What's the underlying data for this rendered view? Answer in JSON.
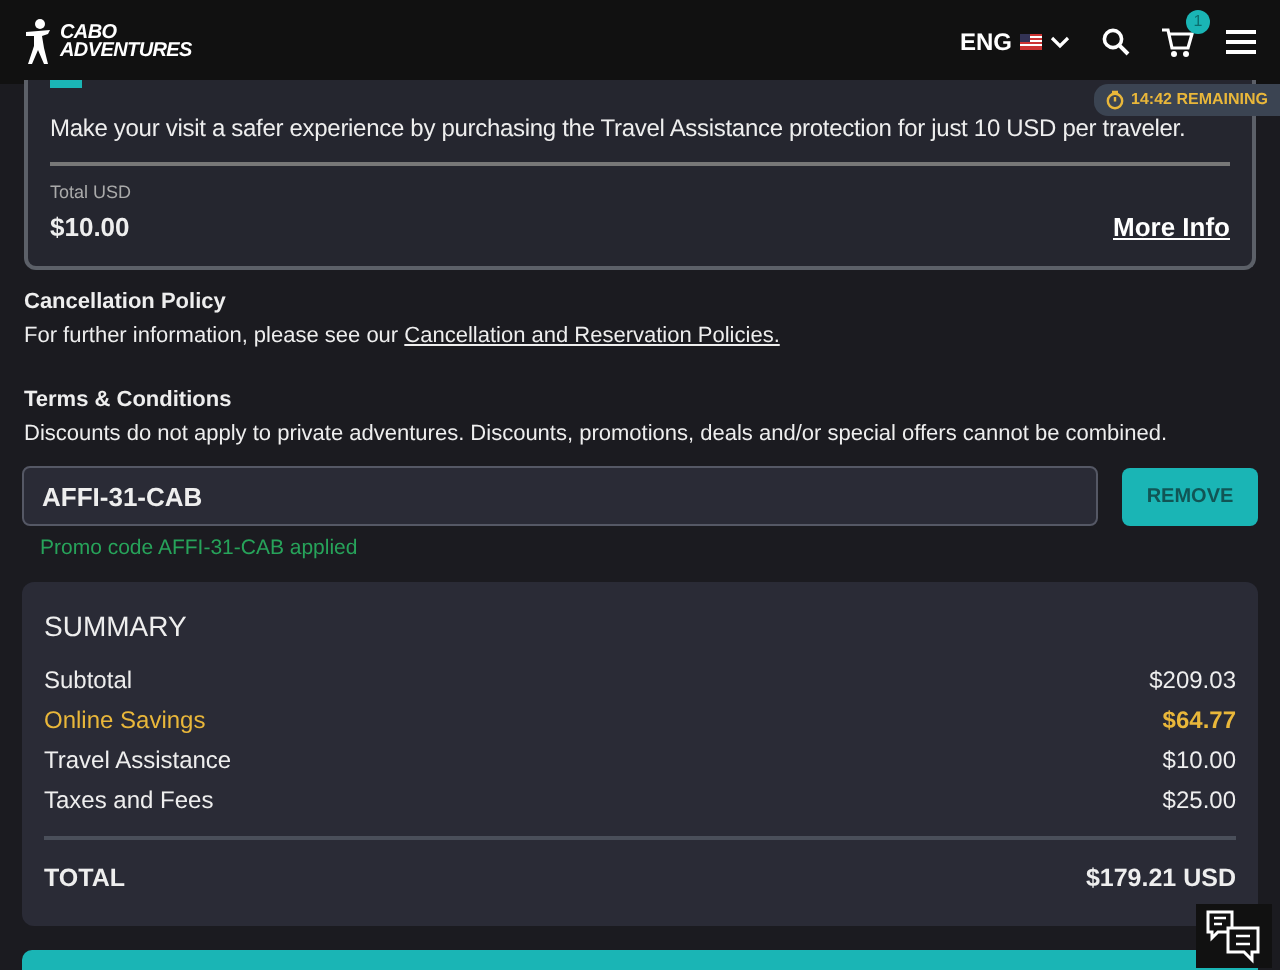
{
  "header": {
    "logo_lines": [
      "CABO",
      "ADVENTURES"
    ],
    "language": "ENG",
    "cart_count": "1"
  },
  "timer": "14:42 REMAINING",
  "travel_assistance": {
    "description": "Make your visit a safer experience by purchasing the Travel Assistance protection for just 10 USD per traveler.",
    "total_label": "Total USD",
    "total": "$10.00",
    "link": "More Info"
  },
  "policies": [
    {
      "title": "Cancellation Policy",
      "text": "For further information, please see our ",
      "link": "Cancellation and Reservation Policies."
    },
    {
      "title": "Terms & Conditions",
      "text": "Discounts do not apply to private adventures. Discounts, promotions, deals and/or special offers cannot be combined."
    }
  ],
  "promo": {
    "value": "AFFI-31-CAB",
    "button": "REMOVE",
    "message": "Promo code AFFI-31-CAB applied"
  },
  "summary": {
    "title": "SUMMARY",
    "rows": [
      {
        "label": "Subtotal",
        "amount": "$209.03",
        "kind": "normal"
      },
      {
        "label": "Online Savings",
        "amount": "$64.77",
        "kind": "savings"
      },
      {
        "label": "Travel Assistance",
        "amount": "$10.00",
        "kind": "normal"
      },
      {
        "label": "Taxes and Fees",
        "amount": "$25.00",
        "kind": "normal"
      }
    ],
    "total_label": "TOTAL",
    "total": "$179.21 USD"
  }
}
